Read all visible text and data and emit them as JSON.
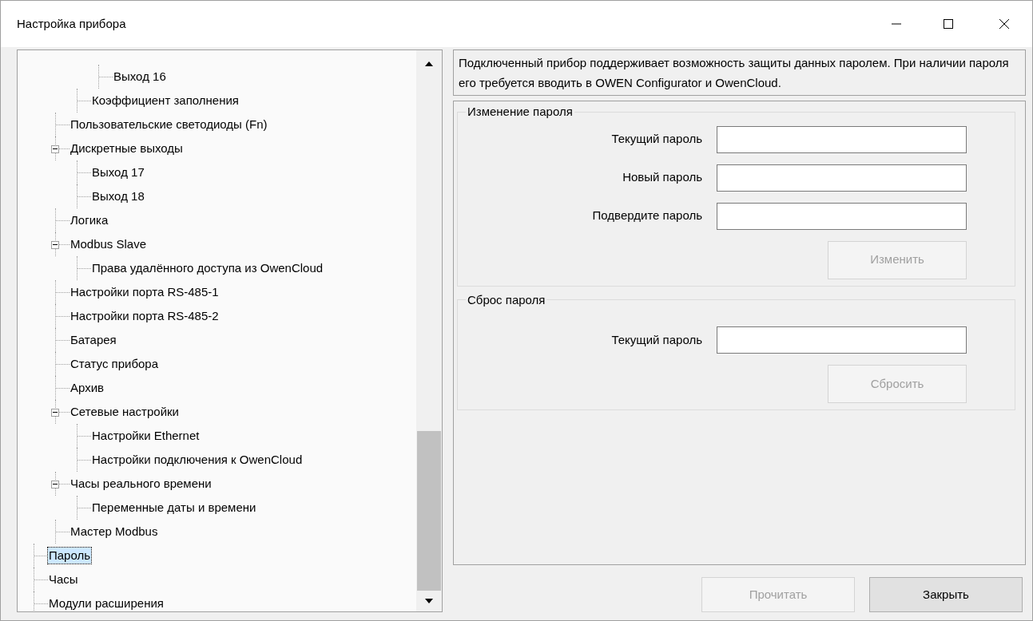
{
  "window": {
    "title": "Настройка прибора"
  },
  "tree": [
    {
      "children": [
        {
          "children": [
            {
              "label": "Выход 16",
              "selected": false
            }
          ]
        },
        {
          "label": "Коэффициент заполнения",
          "selected": false
        }
      ]
    },
    {
      "label": "Пользовательские светодиоды (Fn)",
      "selected": false
    },
    {
      "label": "Дискретные выходы",
      "selected": false,
      "expanded": true,
      "children": [
        {
          "label": "Выход 17",
          "selected": false
        },
        {
          "label": "Выход 18",
          "selected": false
        }
      ]
    },
    {
      "label": "Логика",
      "selected": false
    },
    {
      "label": "Modbus Slave",
      "selected": false,
      "expanded": true,
      "children": [
        {
          "label": "Права удалённого доступа из OwenCloud",
          "selected": false
        }
      ]
    },
    {
      "label": "Настройки порта RS-485-1",
      "selected": false
    },
    {
      "label": "Настройки порта RS-485-2",
      "selected": false
    },
    {
      "label": "Батарея",
      "selected": false
    },
    {
      "label": "Статус прибора",
      "selected": false
    },
    {
      "label": "Архив",
      "selected": false
    },
    {
      "label": "Сетевые настройки",
      "selected": false,
      "expanded": true,
      "children": [
        {
          "label": "Настройки Ethernet",
          "selected": false
        },
        {
          "label": "Настройки подключения к OwenCloud",
          "selected": false
        }
      ]
    },
    {
      "label": "Часы реального времени",
      "selected": false,
      "expanded": true,
      "children": [
        {
          "label": "Переменные даты и времени",
          "selected": false
        }
      ]
    },
    {
      "label": "Мастер Modbus",
      "selected": false
    }
  ],
  "root_items": [
    {
      "label": "Пароль",
      "selected": true
    },
    {
      "label": "Часы",
      "selected": false
    },
    {
      "label": "Модули расширения",
      "selected": false
    }
  ],
  "info": "Подключенный прибор поддерживает возможность защиты данных паролем. При наличии пароля его требуется вводить в OWEN Configurator и OwenCloud.",
  "groups": [
    {
      "title": "Изменение пароля",
      "fields": [
        {
          "label": "Текущий пароль"
        },
        {
          "label": "Новый пароль"
        },
        {
          "label": "Подвердите пароль"
        }
      ],
      "button": {
        "label": "Изменить",
        "disabled": true
      }
    },
    {
      "title": "Сброс пароля",
      "fields": [
        {
          "label": "Текущий пароль"
        }
      ],
      "button": {
        "label": "Сбросить",
        "disabled": true
      }
    }
  ],
  "buttons": [
    {
      "label": "Прочитать",
      "disabled": true
    },
    {
      "label": "Закрыть",
      "disabled": false
    }
  ]
}
